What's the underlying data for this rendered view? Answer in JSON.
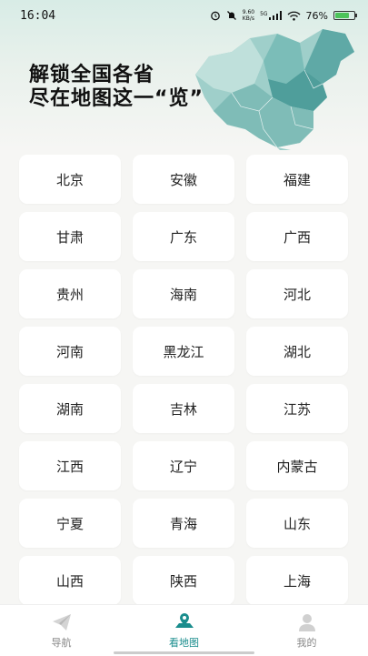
{
  "status": {
    "time": "16:04",
    "speed_value": "9.60",
    "speed_unit": "KB/s",
    "network": "5G",
    "battery": "76%",
    "battery_level": 0.76
  },
  "header": {
    "line1": "解锁全国各省",
    "line2": "尽在地图这一“览”"
  },
  "provinces": [
    "北京",
    "安徽",
    "福建",
    "甘肃",
    "广东",
    "广西",
    "贵州",
    "海南",
    "河北",
    "河南",
    "黑龙江",
    "湖北",
    "湖南",
    "吉林",
    "江苏",
    "江西",
    "辽宁",
    "内蒙古",
    "宁夏",
    "青海",
    "山东",
    "山西",
    "陕西",
    "上海"
  ],
  "tabs": [
    {
      "label": "导航",
      "icon": "paper-plane-icon"
    },
    {
      "label": "看地图",
      "icon": "map-pin-icon"
    },
    {
      "label": "我的",
      "icon": "user-icon"
    }
  ],
  "colors": {
    "accent": "#1a8d8d",
    "inactive": "#888888"
  }
}
